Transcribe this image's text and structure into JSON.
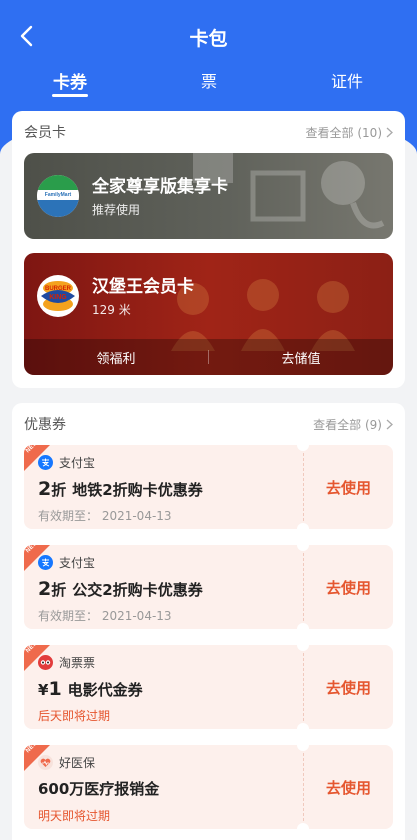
{
  "header": {
    "title": "卡包",
    "tabs": [
      {
        "label": "卡券",
        "active": true
      },
      {
        "label": "票",
        "active": false
      },
      {
        "label": "证件",
        "active": false
      }
    ],
    "background_color": "#2f6ff2"
  },
  "membership": {
    "title": "会员卡",
    "view_all": "查看全部 (10)",
    "cards": [
      {
        "name": "全家尊享版集享卡",
        "subtitle": "推荐使用",
        "logo_text": "FamilyMart"
      },
      {
        "name": "汉堡王会员卡",
        "subtitle": "129 米",
        "logo_text_top": "BURGER",
        "logo_text_bottom": "KING",
        "actions": [
          "领福利",
          "去储值"
        ]
      }
    ]
  },
  "coupons": {
    "title": "优惠券",
    "view_all": "查看全部 (9)",
    "badge": "NEW",
    "items": [
      {
        "provider": "支付宝",
        "icon": "alipay-icon",
        "amount": "2",
        "unit": "折",
        "name": "地铁2折购卡优惠券",
        "expiry": "有效期至：  2021-04-13",
        "expiry_warn": false,
        "action": "去使用"
      },
      {
        "provider": "支付宝",
        "icon": "alipay-icon",
        "amount": "2",
        "unit": "折",
        "name": "公交2折购卡优惠券",
        "expiry": "有效期至：  2021-04-13",
        "expiry_warn": false,
        "action": "去使用"
      },
      {
        "provider": "淘票票",
        "icon": "taopiaopiao-icon",
        "amount": "1",
        "unit": "¥",
        "name": "电影代金券",
        "expiry": "后天即将过期",
        "expiry_warn": true,
        "action": "去使用"
      },
      {
        "provider": "好医保",
        "icon": "haoyibao-icon",
        "amount": "",
        "unit": "",
        "name": "600万医疗报销金",
        "expiry": "明天即将过期",
        "expiry_warn": true,
        "action": "去使用"
      }
    ]
  }
}
